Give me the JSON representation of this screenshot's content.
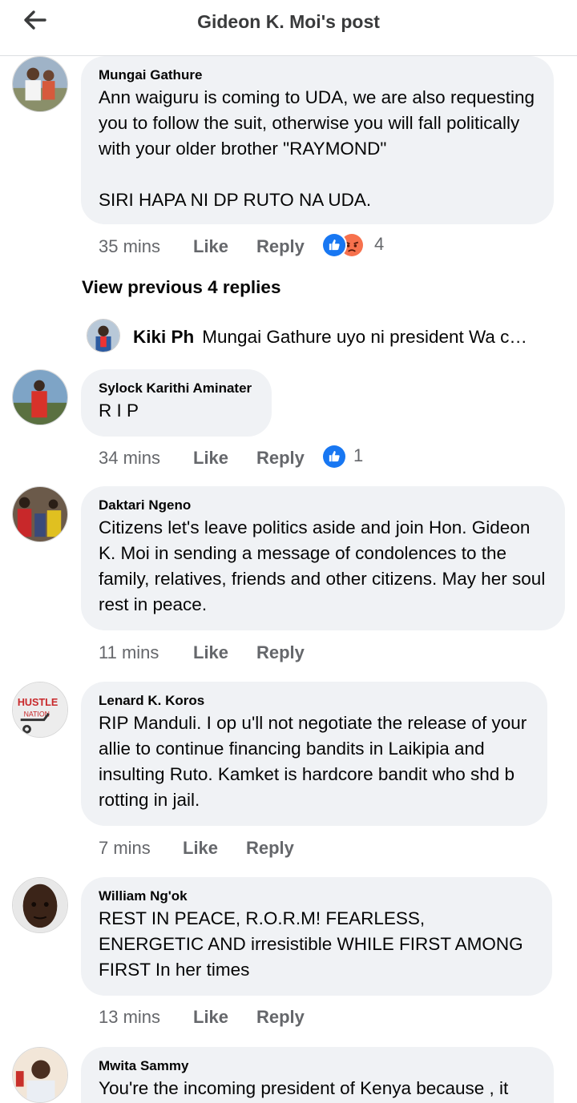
{
  "header": {
    "title": "Gideon K. Moi's post",
    "back_icon": "arrow-left-icon"
  },
  "comments": [
    {
      "author": "Mungai Gathure",
      "text": "Ann waiguru is coming to UDA, we are also requesting you to follow the suit, otherwise you will fall politically with your older brother \"RAYMOND\"\n\nSIRI HAPA NI DP RUTO NA UDA.",
      "time": "35 mins",
      "like": "Like",
      "reply": "Reply",
      "reactions": [
        "like-reaction-icon",
        "angry-reaction-icon"
      ],
      "reaction_count": "4"
    },
    {
      "author": "Sylock Karithi Aminater",
      "text": "R I P",
      "time": "34 mins",
      "like": "Like",
      "reply": "Reply",
      "reactions": [
        "like-reaction-icon"
      ],
      "reaction_count": "1"
    },
    {
      "author": "Daktari Ngeno",
      "text": "Citizens let's leave politics aside and join Hon. Gideon K. Moi in sending a message of condolences to the family, relatives, friends and other citizens. May her soul rest in peace.",
      "time": "11 mins",
      "like": "Like",
      "reply": "Reply"
    },
    {
      "author": "Lenard K. Koros",
      "text": "RIP Manduli. I op u'll not negotiate the release of your allie to continue financing bandits in Laikipia and insulting Ruto. Kamket is hardcore bandit who shd b rotting in jail.",
      "time": "7 mins",
      "like": "Like",
      "reply": "Reply"
    },
    {
      "author": "William Ng'ok",
      "text": "REST IN PEACE, R.O.R.M! FEARLESS, ENERGETIC AND irresistible WHILE FIRST AMONG FIRST In her times",
      "time": "13 mins",
      "like": "Like",
      "reply": "Reply"
    },
    {
      "author": "Mwita Sammy",
      "text": "You're the incoming president of Kenya because , it"
    }
  ],
  "view_previous": "View previous 4 replies",
  "reply_preview": {
    "author": "Kiki Ph",
    "text": "Mungai Gathure uyo ni president Wa c…"
  },
  "colors": {
    "bubble": "#f0f2f5",
    "meta_text": "#65676b",
    "like_blue": "#1877f2",
    "angry_orange": "#f7714d"
  }
}
